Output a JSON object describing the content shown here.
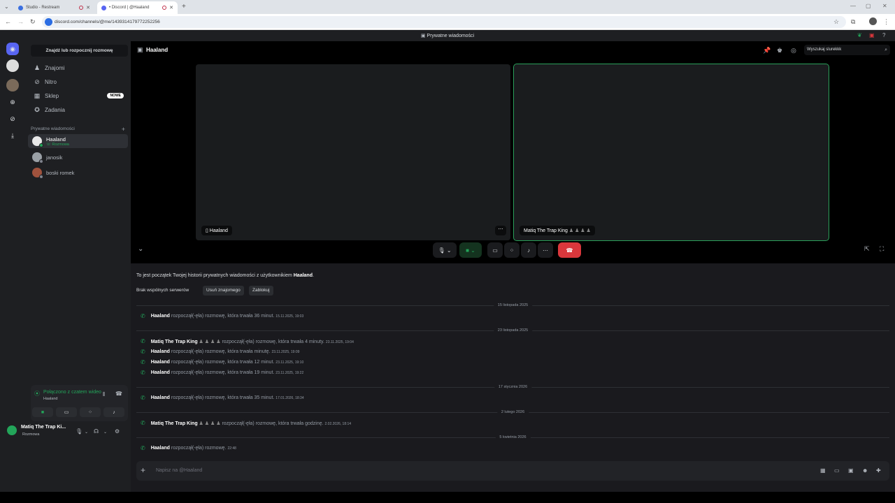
{
  "browser": {
    "tabs": [
      {
        "title": "Studio - Restream",
        "favicon_color": "#3a6fe0"
      },
      {
        "title": "• Discord | @Haaland",
        "favicon_color": "#5865f2"
      }
    ],
    "url": "discord.com/channels/@me/1439314179772252256"
  },
  "titlebar": {
    "title": "Prywatne wiadomości"
  },
  "sidebar": {
    "find_button": "Znajdź lub rozpocznij rozmowę",
    "nav": [
      {
        "label": "Znajomi",
        "icon": "friends-icon"
      },
      {
        "label": "Nitro",
        "icon": "nitro-icon"
      },
      {
        "label": "Sklep",
        "icon": "shop-icon",
        "badge": "NOWE"
      },
      {
        "label": "Zadania",
        "icon": "quests-icon"
      }
    ],
    "dm_section": "Prywatne wiadomości",
    "dms": [
      {
        "name": "Haaland",
        "sub": "Rozmowa",
        "active": true,
        "avatar_color": "#e8e8e8",
        "status_color": "#23a55a"
      },
      {
        "name": "janosik",
        "sub": "",
        "active": false,
        "avatar_color": "#9aa0a6",
        "status_color": "#80848e"
      },
      {
        "name": "boski romek",
        "sub": "",
        "active": false,
        "avatar_color": "#a0523d",
        "status_color": "#80848e"
      }
    ],
    "voice": {
      "title": "Połączono z czatem wideo",
      "sub": "Haaland"
    },
    "user": {
      "name": "Matiq The Trap Ki...",
      "status": "Rozmowa"
    }
  },
  "channel": {
    "name": "Haaland",
    "search_placeholder": "Wyszukaj slurekkk"
  },
  "call": {
    "tiles": [
      {
        "label": "Haaland"
      },
      {
        "label": "Matiq The Trap King"
      }
    ]
  },
  "chat": {
    "intro_prefix": "To jest początek Twojej historii prywatnych wiadomości z użytkownikiem",
    "intro_name": "Haaland",
    "intro_suffix": ".",
    "no_servers": "Brak wspólnych serwerów",
    "remove_friend": "Usuń znajomego",
    "block": "Zablokuj",
    "dates": [
      "15 listopada 2025",
      "23 listopada 2025",
      "17 stycznia 2026",
      "2 lutego 2026",
      "5 kwietnia 2026"
    ],
    "messages": [
      {
        "who": "Haaland",
        "text": "rozpoczął(-ęła) rozmowę, która trwała 36 minut.",
        "ts": "15.11.2025, 19:03"
      },
      {
        "who": "Matiq The Trap King",
        "text": "rozpoczął(-ęła) rozmowę, która trwała 4 minuty.",
        "ts": "23.11.2025, 19:04"
      },
      {
        "who": "Haaland",
        "text": "rozpoczął(-ęła) rozmowę, która trwała minutę.",
        "ts": "23.11.2025, 19:09"
      },
      {
        "who": "Haaland",
        "text": "rozpoczął(-ęła) rozmowę, która trwała 12 minut.",
        "ts": "23.11.2025, 19:10"
      },
      {
        "who": "Haaland",
        "text": "rozpoczął(-ęła) rozmowę, która trwała 19 minut.",
        "ts": "23.11.2025, 19:22"
      },
      {
        "who": "Haaland",
        "text": "rozpoczął(-ęła) rozmowę, która trwała 35 minut.",
        "ts": "17.01.2026, 18:34"
      },
      {
        "who": "Matiq The Trap King",
        "text": "rozpoczął(-ęła) rozmowę, która trwała godzinę.",
        "ts": "2.02.2026, 18:14"
      },
      {
        "who": "Haaland",
        "text": "rozpoczął(-ęła) rozmowę.",
        "ts": "22:48"
      }
    ],
    "composer_placeholder": "Napisz na @Haaland"
  },
  "colors": {
    "accent_green": "#23a55a",
    "hangup_red": "#da373c",
    "blurple": "#5865f2"
  }
}
